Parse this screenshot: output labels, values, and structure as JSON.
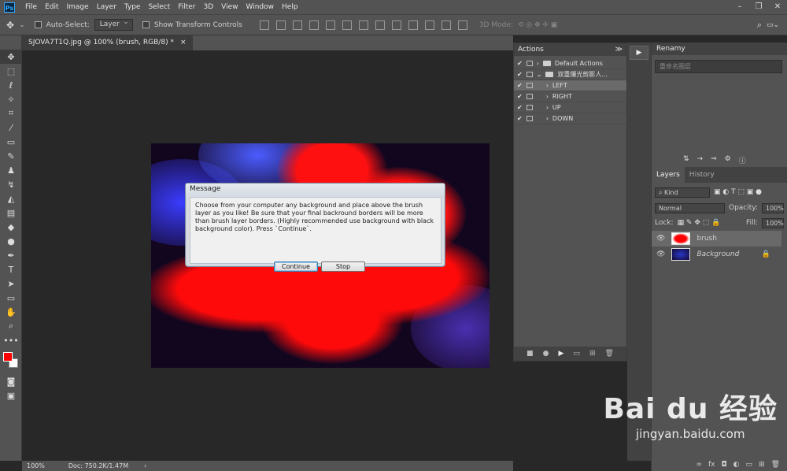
{
  "menubar": {
    "logo": "Ps",
    "items": [
      "File",
      "Edit",
      "Image",
      "Layer",
      "Type",
      "Select",
      "Filter",
      "3D",
      "View",
      "Window",
      "Help"
    ],
    "window_controls": [
      "–",
      "❐",
      "✕"
    ]
  },
  "options": {
    "auto_select_label": "Auto-Select:",
    "auto_select_value": "Layer",
    "show_transform_label": "Show Transform Controls",
    "mode_3d": "3D Mode:"
  },
  "document": {
    "tab_title": "SJOVA7T1Q.jpg @ 100% (brush, RGB/8) *",
    "close": "×"
  },
  "status": {
    "zoom": "100%",
    "doc": "Doc: 750.2K/1.47M",
    "arrow": "›"
  },
  "dialog": {
    "title": "Message",
    "message": "Choose from your computer any background and place above the brush layer as you like! Be sure that your final backround borders will be more than brush layer borders. (Highly recommended use background with black background color). Press `Continue`.",
    "continue": "Continue",
    "stop": "Stop"
  },
  "actions_panel": {
    "title": "Actions",
    "menu_glyph": "≫",
    "rows": [
      {
        "label": "Default Actions",
        "type": "folder",
        "expanded": false
      },
      {
        "label": "双重爆光剪影人...",
        "type": "folder",
        "expanded": true
      },
      {
        "label": "LEFT",
        "type": "action",
        "selected": true
      },
      {
        "label": "RIGHT",
        "type": "action"
      },
      {
        "label": "UP",
        "type": "action"
      },
      {
        "label": "DOWN",
        "type": "action"
      }
    ],
    "footer": [
      "■",
      "●",
      "▶",
      "▭",
      "⊞",
      "🗑"
    ]
  },
  "renamy": {
    "title": "Renamy",
    "placeholder": "重命名图层"
  },
  "layers_panel": {
    "tabs": [
      "Layers",
      "History"
    ],
    "kind": "Kind",
    "blend": "Normal",
    "opacity_label": "Opacity:",
    "opacity": "100%",
    "lock_label": "Lock:",
    "fill_label": "Fill:",
    "fill": "100%",
    "layers": [
      {
        "name": "brush",
        "selected": true
      },
      {
        "name": "Background",
        "locked": true
      }
    ],
    "footer": [
      "∞",
      "fx",
      "◘",
      "◐",
      "▭",
      "⊞",
      "🗑"
    ]
  },
  "colors": {
    "foreground": "#ff0000",
    "background": "#ffffff",
    "accent": "#31a8ff"
  },
  "watermark": {
    "brand": "Bai du 经验",
    "url": "jingyan.baidu.com"
  }
}
